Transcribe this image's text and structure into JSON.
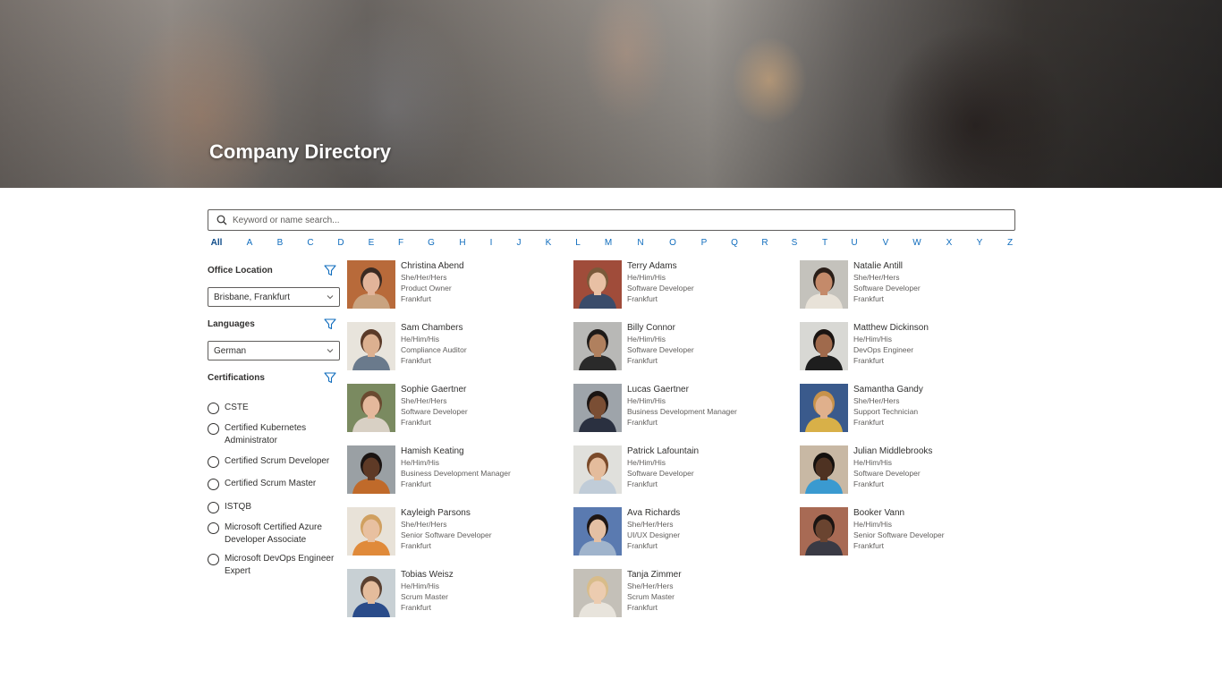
{
  "header": {
    "title": "Company Directory"
  },
  "search": {
    "placeholder": "Keyword or name search..."
  },
  "alphabet": [
    "All",
    "A",
    "B",
    "C",
    "D",
    "E",
    "F",
    "G",
    "H",
    "I",
    "J",
    "K",
    "L",
    "M",
    "N",
    "O",
    "P",
    "Q",
    "R",
    "S",
    "T",
    "U",
    "V",
    "W",
    "X",
    "Y",
    "Z"
  ],
  "alphabet_selected": "All",
  "filters": {
    "office": {
      "label": "Office Location",
      "value": "Brisbane, Frankfurt"
    },
    "languages": {
      "label": "Languages",
      "value": "German"
    },
    "certifications": {
      "label": "Certifications",
      "options": [
        "CSTE",
        "Certified Kubernetes Administrator",
        "Certified Scrum Developer",
        "Certified Scrum Master",
        "ISTQB",
        "Microsoft Certified Azure Developer Associate",
        "Microsoft DevOps Engineer Expert"
      ]
    }
  },
  "people": [
    {
      "name": "Christina Abend",
      "pronouns": "She/Her/Hers",
      "title": "Product Owner",
      "location": "Frankfurt",
      "bg": "#b86a3a",
      "skin": "#e2b49a",
      "hair": "#3a2a22",
      "shirt": "#c9a380"
    },
    {
      "name": "Terry Adams",
      "pronouns": "He/Him/His",
      "title": "Software Developer",
      "location": "Frankfurt",
      "bg": "#a04c3a",
      "skin": "#e8c0a4",
      "hair": "#7a5a3a",
      "shirt": "#3a4c6a"
    },
    {
      "name": "Natalie Antill",
      "pronouns": "She/Her/Hers",
      "title": "Software Developer",
      "location": "Frankfurt",
      "bg": "#c4c2bc",
      "skin": "#c48a6a",
      "hair": "#2a1e18",
      "shirt": "#e8e2d8"
    },
    {
      "name": "Sam Chambers",
      "pronouns": "He/Him/His",
      "title": "Compliance Auditor",
      "location": "Frankfurt",
      "bg": "#e8e4dc",
      "skin": "#dcb090",
      "hair": "#5a3a28",
      "shirt": "#6a7a8c"
    },
    {
      "name": "Billy Connor",
      "pronouns": "He/Him/His",
      "title": "Software Developer",
      "location": "Frankfurt",
      "bg": "#b8b8b6",
      "skin": "#b0805e",
      "hair": "#1e1a18",
      "shirt": "#2a2a2a"
    },
    {
      "name": "Matthew Dickinson",
      "pronouns": "He/Him/His",
      "title": "DevOps Engineer",
      "location": "Frankfurt",
      "bg": "#d8d8d4",
      "skin": "#a06a4c",
      "hair": "#1a1412",
      "shirt": "#1e1e1e"
    },
    {
      "name": "Sophie Gaertner",
      "pronouns": "She/Her/Hers",
      "title": "Software Developer",
      "location": "Frankfurt",
      "bg": "#7a8a60",
      "skin": "#e4b89c",
      "hair": "#6a4a30",
      "shirt": "#d8d0c4"
    },
    {
      "name": "Lucas Gaertner",
      "pronouns": "He/Him/His",
      "title": "Business Development Manager",
      "location": "Frankfurt",
      "bg": "#9ea4aa",
      "skin": "#7a4e34",
      "hair": "#1a1412",
      "shirt": "#2a3040"
    },
    {
      "name": "Samantha Gandy",
      "pronouns": "She/Her/Hers",
      "title": "Support Technician",
      "location": "Frankfurt",
      "bg": "#3a5a8c",
      "skin": "#e0b08c",
      "hair": "#c8924a",
      "shirt": "#d8b048"
    },
    {
      "name": "Hamish Keating",
      "pronouns": "He/Him/His",
      "title": "Business Development Manager",
      "location": "Frankfurt",
      "bg": "#9aa0a4",
      "skin": "#5e3a26",
      "hair": "#1a1412",
      "shirt": "#c06a2a"
    },
    {
      "name": "Patrick Lafountain",
      "pronouns": "He/Him/His",
      "title": "Software Developer",
      "location": "Frankfurt",
      "bg": "#e0e0dc",
      "skin": "#e4bc9c",
      "hair": "#7a4a2a",
      "shirt": "#c0ccd8"
    },
    {
      "name": "Julian Middlebrooks",
      "pronouns": "He/Him/His",
      "title": "Software Developer",
      "location": "Frankfurt",
      "bg": "#c8b8a4",
      "skin": "#4e3222",
      "hair": "#14100e",
      "shirt": "#3a9ad0"
    },
    {
      "name": "Kayleigh Parsons",
      "pronouns": "She/Her/Hers",
      "title": "Senior Software Developer",
      "location": "Frankfurt",
      "bg": "#e8e2d8",
      "skin": "#e8c0a0",
      "hair": "#d0a060",
      "shirt": "#e08a3a"
    },
    {
      "name": "Ava Richards",
      "pronouns": "She/Her/Hers",
      "title": "UI/UX Designer",
      "location": "Frankfurt",
      "bg": "#5a7ab0",
      "skin": "#e4c0a4",
      "hair": "#1e1614",
      "shirt": "#a0b4cc"
    },
    {
      "name": "Booker Vann",
      "pronouns": "He/Him/His",
      "title": "Senior Software Developer",
      "location": "Frankfurt",
      "bg": "#a86a54",
      "skin": "#6a4430",
      "hair": "#1a1412",
      "shirt": "#3a3a44"
    },
    {
      "name": "Tobias Weisz",
      "pronouns": "He/Him/His",
      "title": "Scrum Master",
      "location": "Frankfurt",
      "bg": "#c8d0d4",
      "skin": "#e4bc9c",
      "hair": "#5a4030",
      "shirt": "#2a4c8a"
    },
    {
      "name": "Tanja Zimmer",
      "pronouns": "She/Her/Hers",
      "title": "Scrum Master",
      "location": "Frankfurt",
      "bg": "#c4c0b8",
      "skin": "#ecccb0",
      "hair": "#d8bc8a",
      "shirt": "#e8e4dc"
    }
  ]
}
